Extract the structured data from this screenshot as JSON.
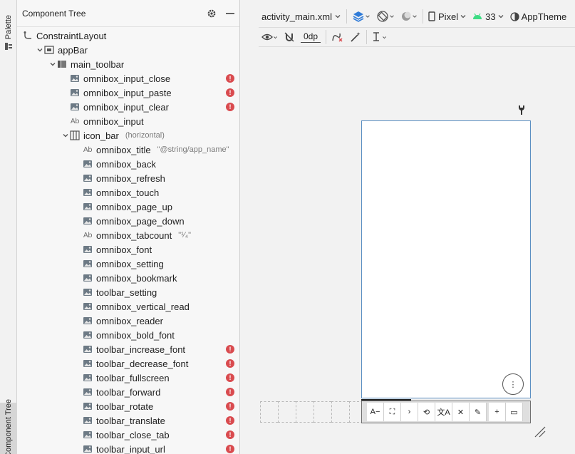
{
  "side_tabs": {
    "palette": "Palette",
    "component_tree": "Component Tree"
  },
  "tree": {
    "title": "Component Tree",
    "rows": [
      {
        "label": "ConstraintLayout",
        "sub": "",
        "error": false
      },
      {
        "label": "appBar",
        "sub": "",
        "error": false
      },
      {
        "label": "main_toolbar",
        "sub": "",
        "error": false
      },
      {
        "label": "omnibox_input_close",
        "sub": "",
        "error": true
      },
      {
        "label": "omnibox_input_paste",
        "sub": "",
        "error": true
      },
      {
        "label": "omnibox_input_clear",
        "sub": "",
        "error": true
      },
      {
        "label": "omnibox_input",
        "sub": "",
        "error": false
      },
      {
        "label": "icon_bar",
        "sub": "(horizontal)",
        "error": false
      },
      {
        "label": "omnibox_title",
        "sub": "\"@string/app_name\"",
        "error": false
      },
      {
        "label": "omnibox_back",
        "sub": "",
        "error": false
      },
      {
        "label": "omnibox_refresh",
        "sub": "",
        "error": false
      },
      {
        "label": "omnibox_touch",
        "sub": "",
        "error": false
      },
      {
        "label": "omnibox_page_up",
        "sub": "",
        "error": false
      },
      {
        "label": "omnibox_page_down",
        "sub": "",
        "error": false
      },
      {
        "label": "omnibox_tabcount",
        "sub": "\"¹⁄₄\"",
        "error": false
      },
      {
        "label": "omnibox_font",
        "sub": "",
        "error": false
      },
      {
        "label": "omnibox_setting",
        "sub": "",
        "error": false
      },
      {
        "label": "omnibox_bookmark",
        "sub": "",
        "error": false
      },
      {
        "label": "toolbar_setting",
        "sub": "",
        "error": false
      },
      {
        "label": "omnibox_vertical_read",
        "sub": "",
        "error": false
      },
      {
        "label": "omnibox_reader",
        "sub": "",
        "error": false
      },
      {
        "label": "omnibox_bold_font",
        "sub": "",
        "error": false
      },
      {
        "label": "toolbar_increase_font",
        "sub": "",
        "error": true
      },
      {
        "label": "toolbar_decrease_font",
        "sub": "",
        "error": true
      },
      {
        "label": "toolbar_fullscreen",
        "sub": "",
        "error": true
      },
      {
        "label": "toolbar_forward",
        "sub": "",
        "error": true
      },
      {
        "label": "toolbar_rotate",
        "sub": "",
        "error": true
      },
      {
        "label": "toolbar_translate",
        "sub": "",
        "error": true
      },
      {
        "label": "toolbar_close_tab",
        "sub": "",
        "error": true
      },
      {
        "label": "toolbar_input_url",
        "sub": "",
        "error": true
      }
    ]
  },
  "editor_toolbar": {
    "file": "activity_main.xml",
    "device": "Pixel",
    "api": "33",
    "theme": "AppTheme",
    "margin_value": "0dp"
  },
  "preview": {
    "more_glyph": "⋮",
    "iconbar": [
      "A−",
      "⛶",
      "›",
      "⟲",
      "文A",
      "✕",
      "✎",
      "+",
      "▭"
    ]
  }
}
